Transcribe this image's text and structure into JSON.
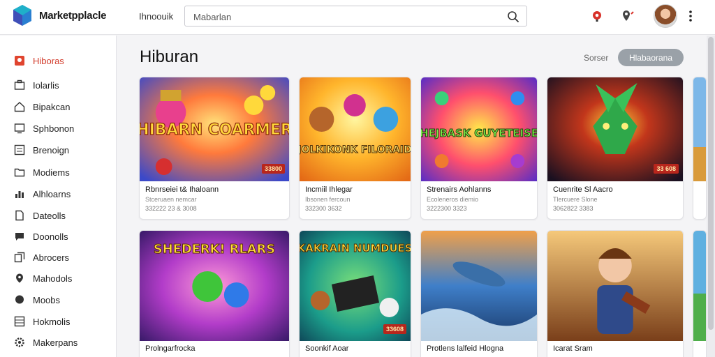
{
  "header": {
    "brand": "Marketpplacle",
    "nav_link": "Ihnoouik",
    "search_value": "Mabarlan"
  },
  "sidebar": {
    "items": [
      {
        "label": "Hiboras",
        "icon": "home-icon",
        "active": true
      },
      {
        "label": "Iolarlis",
        "icon": "briefcase-icon"
      },
      {
        "label": "Bipakcan",
        "icon": "house-icon"
      },
      {
        "label": "Sphbonon",
        "icon": "monitor-icon"
      },
      {
        "label": "Brenoign",
        "icon": "list-icon"
      },
      {
        "label": "Modiems",
        "icon": "folder-icon"
      },
      {
        "label": "Alhloarns",
        "icon": "chart-icon"
      },
      {
        "label": "Dateolls",
        "icon": "document-icon"
      },
      {
        "label": "Doonolls",
        "icon": "chat-icon"
      },
      {
        "label": "Abrocers",
        "icon": "copy-icon"
      },
      {
        "label": "Mahodols",
        "icon": "pin-icon"
      },
      {
        "label": "Moobs",
        "icon": "bubble-icon"
      },
      {
        "label": "Hokmolis",
        "icon": "grid-icon"
      },
      {
        "label": "Makerpans",
        "icon": "gear-icon"
      }
    ]
  },
  "main": {
    "title": "Hiburan",
    "sort_label": "Sorser",
    "sort_button": "Hlabaorana"
  },
  "cards": [
    {
      "thumb_title": "HIBARN COARMER",
      "price": "33800",
      "title": "Rbnrseiei t& Ihaloann",
      "sub": "Stceruaen nemcar",
      "meta": "332222 23 & 3008"
    },
    {
      "thumb_title": "JOLKIKONK FILORAID",
      "price": "",
      "title": "Incmiil Ihlegar",
      "sub": "Ibsonen fercoun",
      "meta": "332300 3632"
    },
    {
      "thumb_title": "HEJBASK GUYETEISE",
      "price": "",
      "title": "Strenairs Aohlanns",
      "sub": "Ecoleneros diemio",
      "meta": "3222300 3323"
    },
    {
      "thumb_title": "",
      "price": "33 608",
      "title": "Cuenrite Sl Aacro",
      "sub": "Tlercuere Slone",
      "meta": "3062822 3383"
    },
    {
      "thumb_title": "SHEDERK! RLARS",
      "price": "",
      "title": "Prolngarfrocka",
      "sub": "",
      "meta": ""
    },
    {
      "thumb_title": "KAKRAIN NUMDUES",
      "price": "33608",
      "title": "Soonkif Aoar",
      "sub": "",
      "meta": ""
    },
    {
      "thumb_title": "",
      "price": "",
      "title": "Protlens lalfeid Hlogna",
      "sub": "",
      "meta": ""
    },
    {
      "thumb_title": "",
      "price": "",
      "title": "Icarat Sram",
      "sub": "",
      "meta": ""
    }
  ]
}
